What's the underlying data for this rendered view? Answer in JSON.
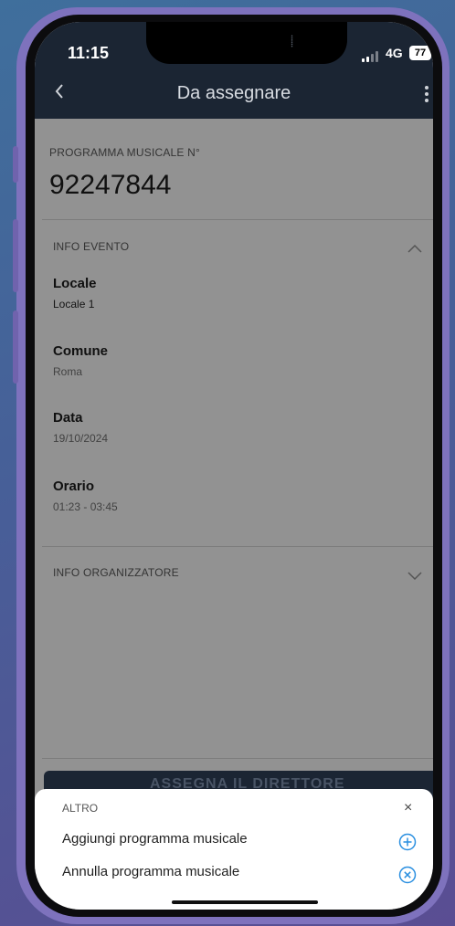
{
  "status_bar": {
    "time": "11:15",
    "network": "4G",
    "battery": "77"
  },
  "header": {
    "title": "Da assegnare"
  },
  "program": {
    "label": "PROGRAMMA MUSICALE N°",
    "number": "92247844"
  },
  "info_evento": {
    "title": "INFO EVENTO",
    "fields": [
      {
        "label": "Locale",
        "value": "Locale 1"
      },
      {
        "label": "Comune",
        "value": "Roma"
      },
      {
        "label": "Data",
        "value": "19/10/2024"
      },
      {
        "label": "Orario",
        "value": "01:23 - 03:45"
      }
    ]
  },
  "info_organizzatore": {
    "title": "INFO ORGANIZZATORE"
  },
  "hidden_action": {
    "label": "ASSEGNA IL DIRETTORE"
  },
  "bottom_sheet": {
    "title": "ALTRO",
    "close": "×",
    "items": [
      {
        "label": "Aggiungi programma musicale",
        "icon": "add-circle-icon"
      },
      {
        "label": "Annulla programma musicale",
        "icon": "cancel-circle-icon"
      }
    ]
  },
  "colors": {
    "accent": "#2a8fe0",
    "header_bg": "#1b2533",
    "frame": "#7e72bd"
  }
}
